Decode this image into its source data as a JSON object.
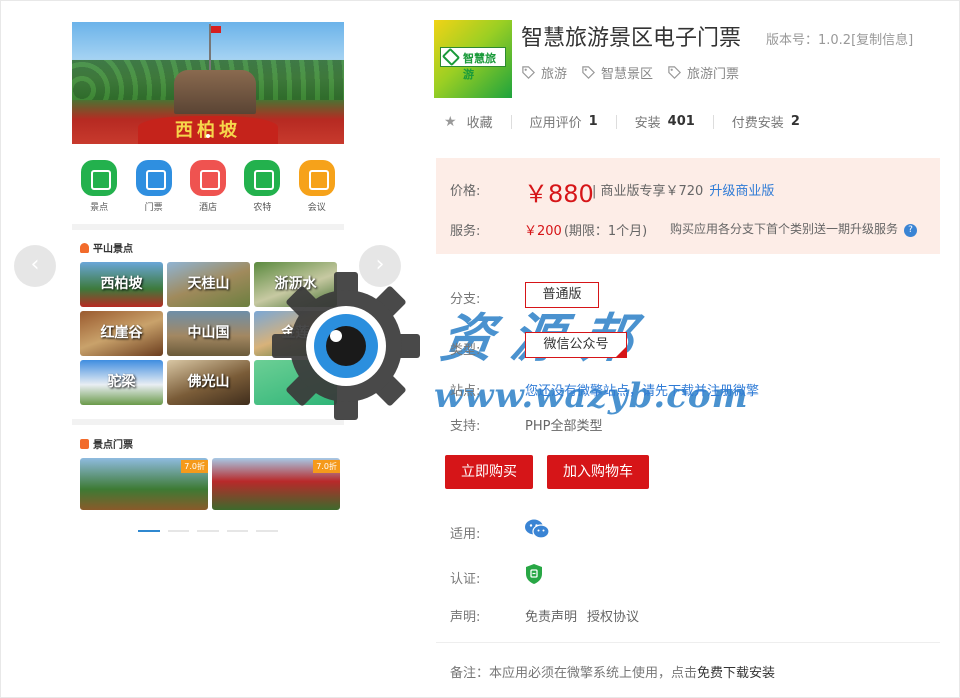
{
  "preview": {
    "banner_sign": "西柏坡",
    "icons": [
      {
        "label": "景点",
        "color": "#23b14d",
        "icon": "temple-icon"
      },
      {
        "label": "门票",
        "color": "#2f8fe0",
        "icon": "ticket-icon"
      },
      {
        "label": "酒店",
        "color": "#ef5350",
        "icon": "hotel-icon"
      },
      {
        "label": "农特",
        "color": "#23b14d",
        "icon": "bag-icon"
      },
      {
        "label": "会议",
        "color": "#f6a21a",
        "icon": "meeting-icon"
      }
    ],
    "section1_title": "平山景点",
    "section1_icon_color": "#f26b2b",
    "tiles": [
      "西柏坡",
      "天桂山",
      "浙沥水",
      "红崖谷",
      "中山国",
      "金莲",
      "驼梁",
      "佛光山",
      ""
    ],
    "section2_title": "景点门票",
    "section2_icon_color": "#f26b2b",
    "tickets": [
      {
        "discount": "7.0折"
      },
      {
        "discount": "7.0折"
      }
    ]
  },
  "app": {
    "title": "智慧旅游景区电子门票",
    "version": "版本号：1.0.2[复制信息]",
    "logo_text": "智慧旅游",
    "tags": [
      "旅游",
      "智慧景区",
      "旅游门票"
    ]
  },
  "stats": {
    "favorite": "收藏",
    "rating_label": "应用评价",
    "rating_value": "1",
    "install_label": "安装",
    "install_value": "401",
    "paid_label": "付费安装",
    "paid_value": "2"
  },
  "pricing": {
    "price_label": "价格:",
    "price": "￥880",
    "price_sub": "| 商业版专享￥720",
    "upgrade_link": "升级商业版",
    "service_label": "服务:",
    "service_price": "￥200",
    "service_period": "(期限：1个月)",
    "service_note": "购买应用各分支下首个类别送一期升级服务",
    "help": "?"
  },
  "options": {
    "branch_label": "分支:",
    "branch_value": "普通版",
    "type_label": "类型:",
    "type_value": "微信公众号",
    "site_label": "站点:",
    "site_value": "您还没有微擎站点，请先下载并注册微擎",
    "support_label": "支持:",
    "support_value": "PHP全部类型"
  },
  "actions": {
    "buy": "立即购买",
    "cart": "加入购物车"
  },
  "meta": {
    "applies_label": "适用:",
    "cert_label": "认证:",
    "declare_label": "声明:",
    "disclaimer": "免责声明",
    "license": "授权协议",
    "note_prefix": "备注：本应用必须在微擎系统上使用，点击",
    "note_link": "免费下载安装"
  },
  "watermark": {
    "text": "资源邦",
    "url": "www.wazyb.com"
  },
  "colors": {
    "accent": "#d61518",
    "link": "#2f7bd6",
    "price_bg": "#fdede7"
  }
}
